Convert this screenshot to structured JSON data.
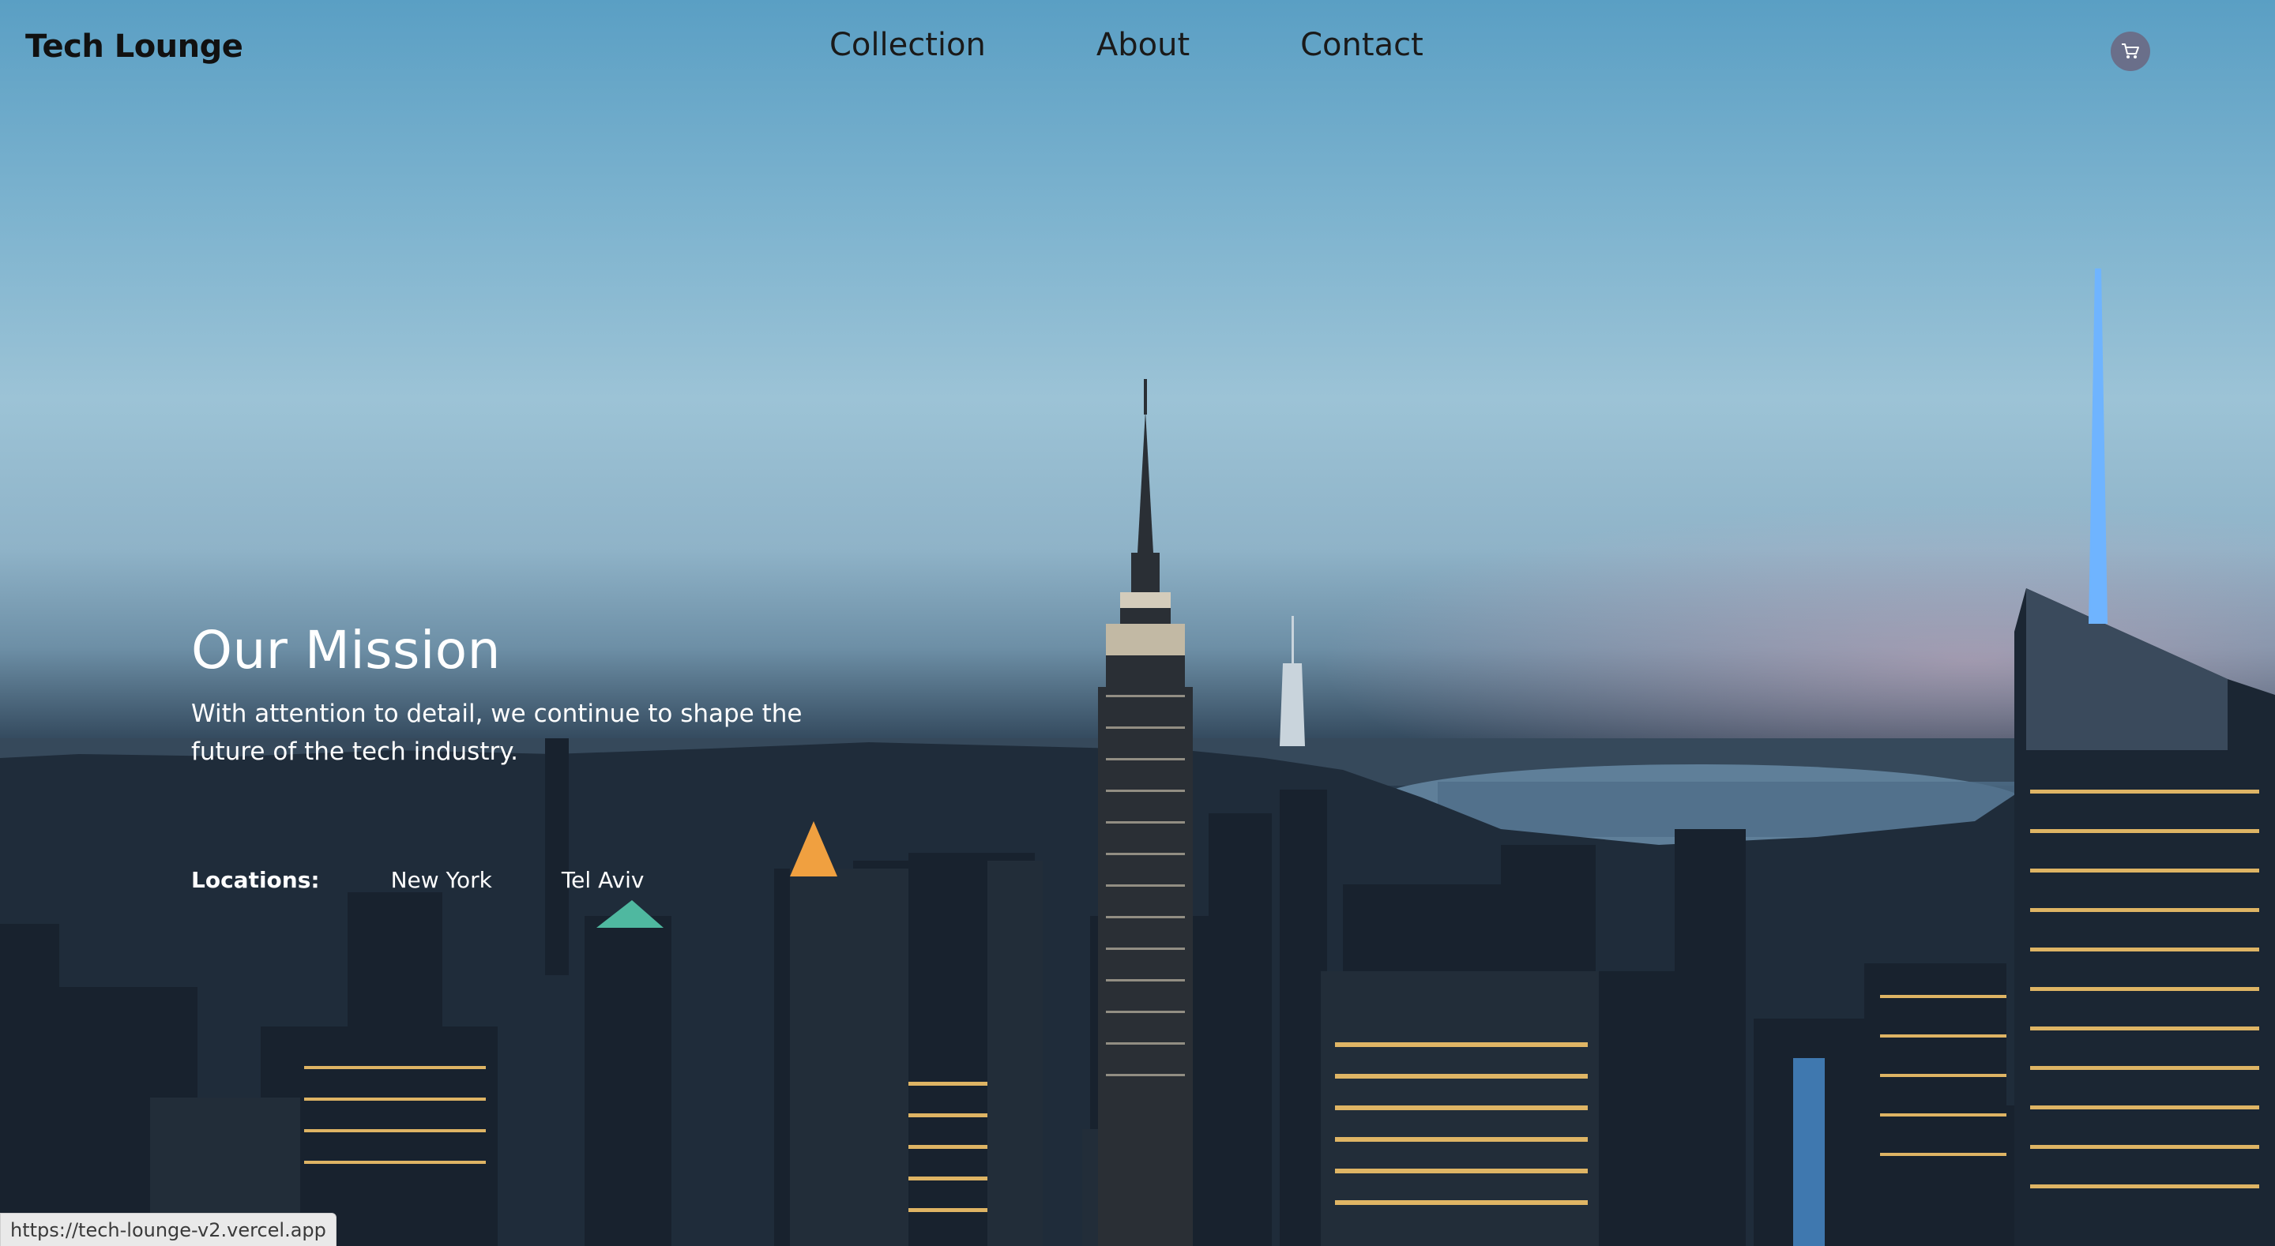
{
  "brand": {
    "name": "Tech Lounge"
  },
  "nav": {
    "items": [
      {
        "label": "Collection"
      },
      {
        "label": "About"
      },
      {
        "label": "Contact"
      }
    ]
  },
  "header": {
    "cart_icon": "cart-icon"
  },
  "hero": {
    "title": "Our Mission",
    "text": "With attention to detail, we continue to shape the future of the tech industry.",
    "background": "night city skyline"
  },
  "locations": {
    "label": "Locations:",
    "items": [
      "New York",
      "Tel Aviv"
    ]
  },
  "status_bar": {
    "url": "https://tech-lounge-v2.vercel.app"
  },
  "colors": {
    "sky_top": "#5a9fc4",
    "sky_mid": "#9cc3d6",
    "city_dark": "#131a23",
    "cart_bg": "#6a6f8a",
    "text_dark": "#111111",
    "text_light": "#ffffff"
  }
}
